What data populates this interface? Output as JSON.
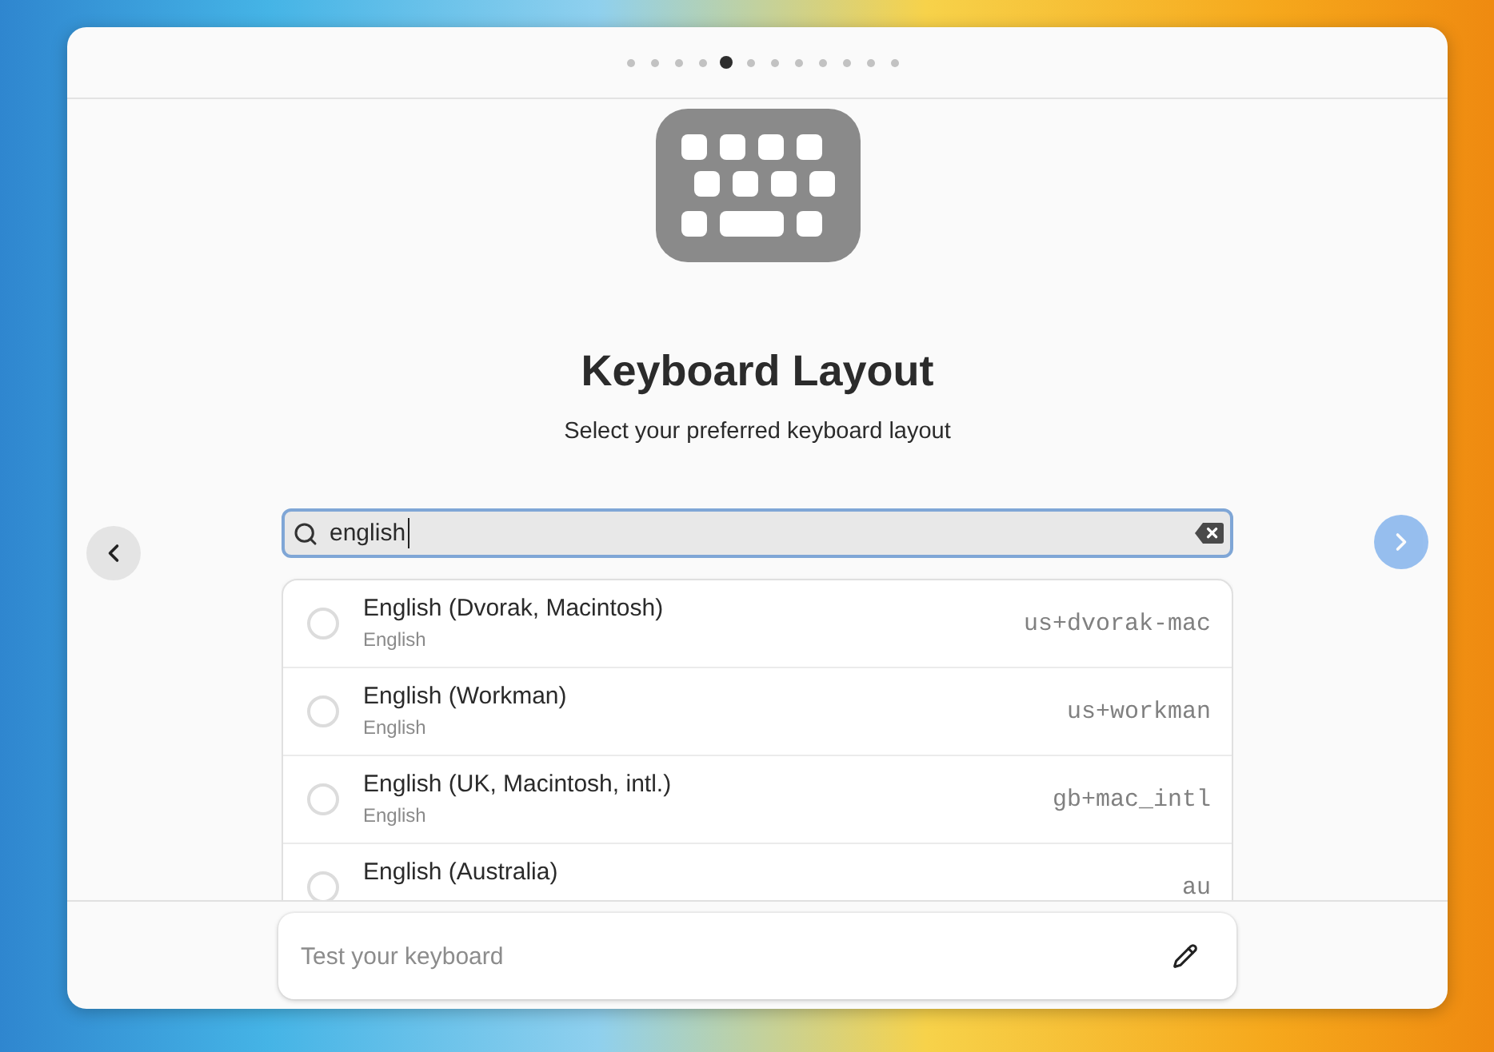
{
  "steps": [
    {
      "selected": false
    },
    {
      "selected": false
    },
    {
      "selected": false
    },
    {
      "selected": false
    },
    {
      "selected": true
    },
    {
      "selected": false
    },
    {
      "selected": false
    },
    {
      "selected": false
    },
    {
      "selected": false
    },
    {
      "selected": false
    },
    {
      "selected": false
    },
    {
      "selected": false
    }
  ],
  "page": {
    "title": "Keyboard Layout",
    "subtitle": "Select your preferred keyboard layout"
  },
  "search": {
    "value": "english",
    "focused": true
  },
  "navigation": {
    "back": {
      "disabled": false
    },
    "next": {
      "disabled": true
    }
  },
  "layouts": [
    {
      "name": "English (Dvorak, Macintosh)",
      "language": "English",
      "code": "us+dvorak-mac",
      "selected": false
    },
    {
      "name": "English (Workman)",
      "language": "English",
      "code": "us+workman",
      "selected": false
    },
    {
      "name": "English (UK, Macintosh, intl.)",
      "language": "English",
      "code": "gb+mac_intl",
      "selected": false
    },
    {
      "name": "English (Australia)",
      "code": "au",
      "selected": false
    }
  ],
  "test_field": {
    "placeholder": "Test your keyboard"
  }
}
